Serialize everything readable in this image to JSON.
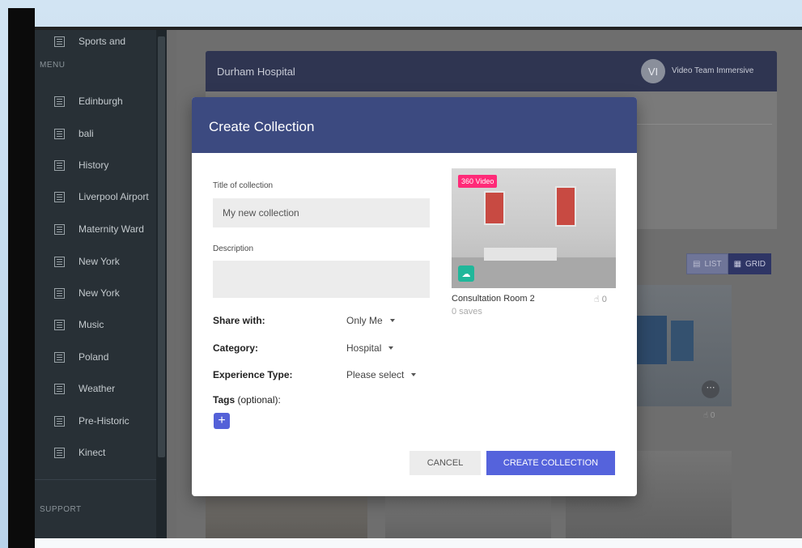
{
  "sidebar": {
    "top_cut_item": "Sports and",
    "menu_label": "MENU",
    "items": [
      {
        "label": "Edinburgh"
      },
      {
        "label": "bali"
      },
      {
        "label": "History"
      },
      {
        "label": "Liverpool Airport"
      },
      {
        "label": "Maternity Ward"
      },
      {
        "label": "New York"
      },
      {
        "label": "New York"
      },
      {
        "label": "Music"
      },
      {
        "label": "Poland"
      },
      {
        "label": "Weather"
      },
      {
        "label": "Pre-Historic"
      },
      {
        "label": "Kinect"
      }
    ],
    "support_label": "SUPPORT"
  },
  "main": {
    "header_title": "Durham Hospital",
    "avatar_initials": "VI",
    "team_name": "Video Team Immersive",
    "view_list_label": "LIST",
    "view_grid_label": "GRID",
    "second_tile_likes": "0"
  },
  "modal": {
    "title": "Create Collection",
    "title_field_label": "Title of collection",
    "title_field_value": "My new collection",
    "description_label": "Description",
    "description_value": "",
    "share_with_label": "Share with:",
    "share_with_value": "Only Me",
    "category_label": "Category:",
    "category_value": "Hospital",
    "experience_type_label": "Experience Type:",
    "experience_type_value": "Please select",
    "tags_label": "Tags",
    "tags_optional": "(optional):",
    "add_tag_symbol": "+",
    "preview": {
      "badge": "360 Video",
      "title": "Consultation Room 2",
      "likes": "0",
      "saves": "0 saves"
    },
    "cancel_label": "CANCEL",
    "create_label": "CREATE COLLECTION"
  },
  "colors": {
    "modal_header": "#3c4a80",
    "primary_button": "#5563dc",
    "badge_pink": "#ff2a78",
    "cloud_teal": "#20b79a",
    "sidebar_bg": "#283036"
  }
}
